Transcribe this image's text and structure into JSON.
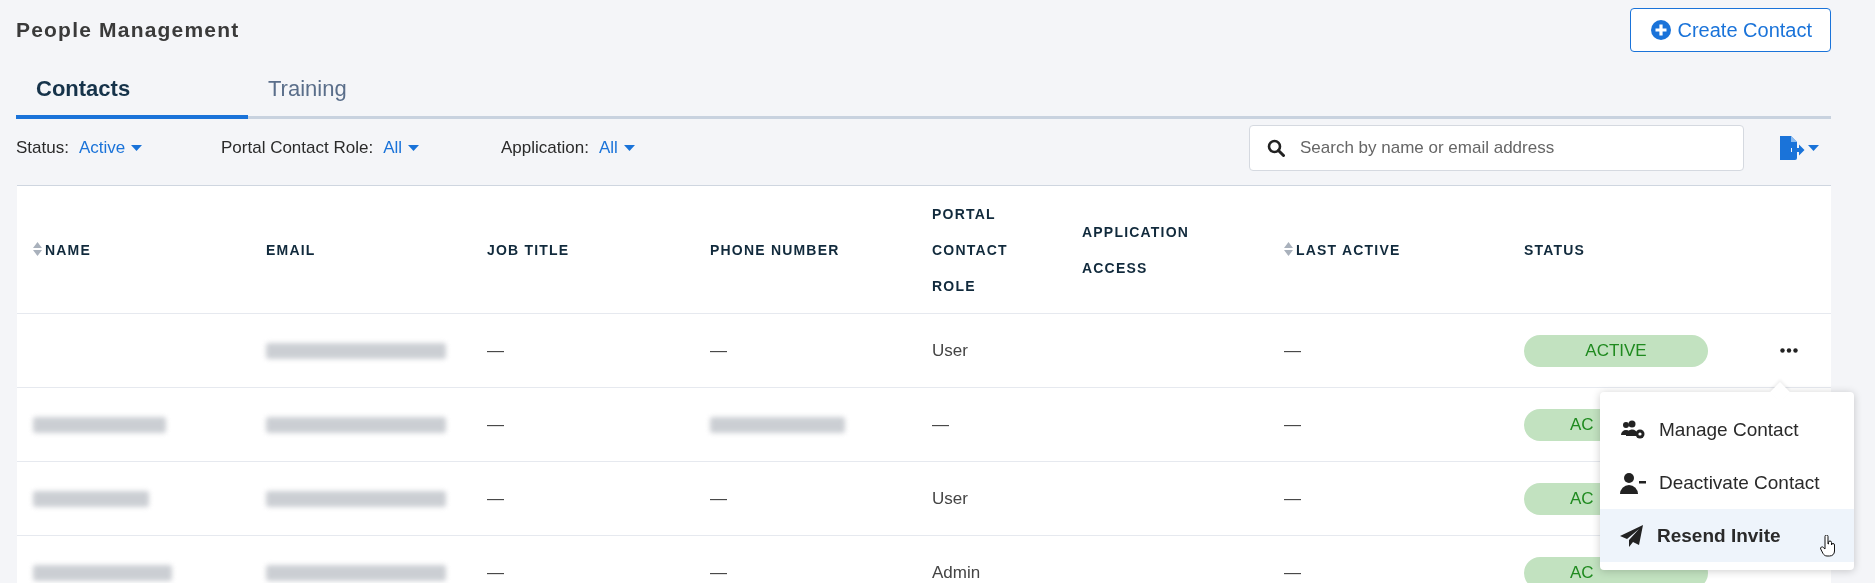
{
  "page": {
    "title": "People Management",
    "create_button": "Create Contact"
  },
  "tabs": [
    {
      "label": "Contacts",
      "selected": true
    },
    {
      "label": "Training",
      "selected": false
    }
  ],
  "filters": [
    {
      "label": "Status:",
      "value": "Active"
    },
    {
      "label": "Portal Contact Role:",
      "value": "All"
    },
    {
      "label": "Application:",
      "value": "All"
    }
  ],
  "search": {
    "placeholder": "Search by name or email address"
  },
  "table": {
    "columns": [
      {
        "label": "NAME",
        "sortable": true
      },
      {
        "label": "EMAIL",
        "sortable": false
      },
      {
        "label": "JOB TITLE",
        "sortable": false
      },
      {
        "label": "PHONE NUMBER",
        "sortable": false
      },
      {
        "label": "PORTAL CONTACT ROLE",
        "sortable": false
      },
      {
        "label": "APPLICATION ACCESS",
        "sortable": false
      },
      {
        "label": "LAST ACTIVE",
        "sortable": true
      },
      {
        "label": "STATUS",
        "sortable": false
      }
    ],
    "rows": [
      {
        "cells": [
          {
            "kind": "empty"
          },
          {
            "kind": "redacted"
          },
          {
            "kind": "text",
            "text": "—"
          },
          {
            "kind": "text",
            "text": "—"
          },
          {
            "kind": "text",
            "text": "User"
          },
          {
            "kind": "empty"
          },
          {
            "kind": "text",
            "text": "—"
          },
          {
            "kind": "status",
            "text": "ACTIVE"
          }
        ],
        "actions": true
      },
      {
        "cells": [
          {
            "kind": "redacted"
          },
          {
            "kind": "redacted"
          },
          {
            "kind": "text",
            "text": "—"
          },
          {
            "kind": "redacted"
          },
          {
            "kind": "text",
            "text": "—"
          },
          {
            "kind": "empty"
          },
          {
            "kind": "text",
            "text": "—"
          },
          {
            "kind": "status",
            "text": "AC"
          }
        ],
        "actions": false
      },
      {
        "cells": [
          {
            "kind": "redacted"
          },
          {
            "kind": "redacted"
          },
          {
            "kind": "text",
            "text": "—"
          },
          {
            "kind": "text",
            "text": "—"
          },
          {
            "kind": "text",
            "text": "User"
          },
          {
            "kind": "empty"
          },
          {
            "kind": "text",
            "text": "—"
          },
          {
            "kind": "status",
            "text": "AC"
          }
        ],
        "actions": false
      },
      {
        "cells": [
          {
            "kind": "redacted"
          },
          {
            "kind": "redacted"
          },
          {
            "kind": "text",
            "text": "—"
          },
          {
            "kind": "text",
            "text": "—"
          },
          {
            "kind": "text",
            "text": "Admin"
          },
          {
            "kind": "empty"
          },
          {
            "kind": "text",
            "text": "—"
          },
          {
            "kind": "status",
            "text": "AC"
          }
        ],
        "actions": false
      }
    ]
  },
  "row_menu": {
    "items": [
      {
        "kind": "manage",
        "label": "Manage Contact",
        "hovered": false
      },
      {
        "kind": "deactivate",
        "label": "Deactivate Contact",
        "hovered": false
      },
      {
        "kind": "resend",
        "label": "Resend Invite",
        "hovered": true
      }
    ]
  }
}
